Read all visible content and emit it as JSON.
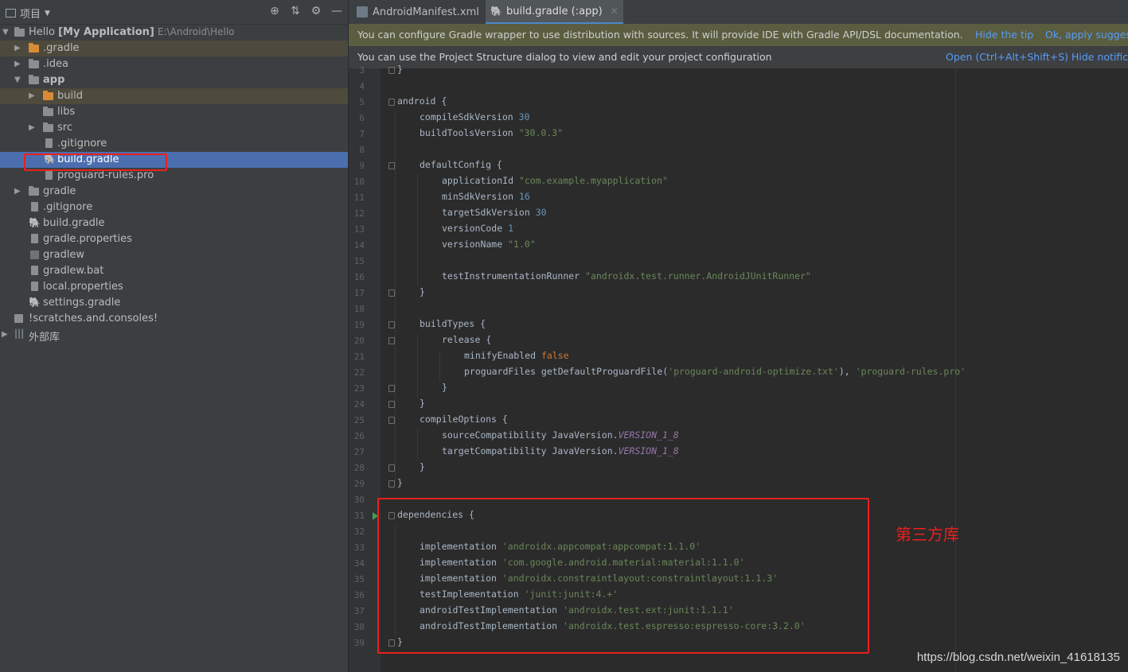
{
  "project_panel": {
    "title": "项目",
    "tree": [
      {
        "label_bold": "Hello",
        "label_extra": "[My Application]",
        "path": "E:\\Android\\Hello"
      },
      {
        "label": ".gradle"
      },
      {
        "label": ".idea"
      },
      {
        "label": "app"
      },
      {
        "label": "build"
      },
      {
        "label": "libs"
      },
      {
        "label": "src"
      },
      {
        "label": ".gitignore"
      },
      {
        "label": "build.gradle"
      },
      {
        "label": "proguard-rules.pro"
      },
      {
        "label": "gradle"
      },
      {
        "label": ".gitignore"
      },
      {
        "label": "build.gradle"
      },
      {
        "label": "gradle.properties"
      },
      {
        "label": "gradlew"
      },
      {
        "label": "gradlew.bat"
      },
      {
        "label": "local.properties"
      },
      {
        "label": "settings.gradle"
      },
      {
        "label": "!scratches.and.consoles!"
      },
      {
        "label": "外部库"
      }
    ]
  },
  "tabs": [
    {
      "label": "AndroidManifest.xml"
    },
    {
      "label": "build.gradle (:app)"
    }
  ],
  "banners": {
    "gradle_wrapper": {
      "message": "You can configure Gradle wrapper to use distribution with sources. It will provide IDE with Gradle API/DSL documentation.",
      "hide_link": "Hide the tip",
      "apply_link": "Ok, apply suggest"
    },
    "project_structure": {
      "message": "You can use the Project Structure dialog to view and edit your project configuration",
      "open_link": "Open (Ctrl+Alt+Shift+S)",
      "hide_link": "Hide notifica"
    }
  },
  "line_numbers": [
    "3",
    "4",
    "5",
    "6",
    "7",
    "8",
    "9",
    "10",
    "11",
    "12",
    "13",
    "14",
    "15",
    "16",
    "17",
    "18",
    "19",
    "20",
    "21",
    "22",
    "23",
    "24",
    "25",
    "26",
    "27",
    "28",
    "29",
    "30",
    "31",
    "32",
    "33",
    "34",
    "35",
    "36",
    "37",
    "38",
    "39"
  ],
  "code": {
    "l3": "}",
    "l5a": "android {",
    "l6a": "compileSdkVersion ",
    "l6b": "30",
    "l7a": "buildToolsVersion ",
    "l7b": "\"30.0.3\"",
    "l9a": "defaultConfig {",
    "l10a": "applicationId ",
    "l10b": "\"com.example.myapplication\"",
    "l11a": "minSdkVersion ",
    "l11b": "16",
    "l12a": "targetSdkVersion ",
    "l12b": "30",
    "l13a": "versionCode ",
    "l13b": "1",
    "l14a": "versionName ",
    "l14b": "\"1.0\"",
    "l16a": "testInstrumentationRunner ",
    "l16b": "\"androidx.test.runner.AndroidJUnitRunner\"",
    "l17": "}",
    "l19": "buildTypes {",
    "l20": "release {",
    "l21a": "minifyEnabled ",
    "l21b": "false",
    "l22a": "proguardFiles getDefaultProguardFile(",
    "l22b": "'proguard-android-optimize.txt'",
    "l22c": "), ",
    "l22d": "'proguard-rules.pro'",
    "l23": "}",
    "l24": "}",
    "l25": "compileOptions {",
    "l26a": "sourceCompatibility JavaVersion.",
    "l26b": "VERSION_1_8",
    "l27a": "targetCompatibility JavaVersion.",
    "l27b": "VERSION_1_8",
    "l28": "}",
    "l29": "}",
    "l31": "dependencies {",
    "l33a": "implementation ",
    "l33b": "'androidx.appcompat:appcompat:1.1.0'",
    "l34a": "implementation ",
    "l34b": "'com.google.android.material:material:1.1.0'",
    "l35a": "implementation ",
    "l35b": "'androidx.constraintlayout:constraintlayout:1.1.3'",
    "l36a": "testImplementation ",
    "l36b": "'junit:junit:4.+'",
    "l37a": "androidTestImplementation ",
    "l37b": "'androidx.test.ext:junit:1.1.1'",
    "l38a": "androidTestImplementation ",
    "l38b": "'androidx.test.espresso:espresso-core:3.2.0'",
    "l39": "}"
  },
  "annotation": "第三方库",
  "watermark": "https://blog.csdn.net/weixin_41618135",
  "colors": {
    "highlight_red": "#e8211d",
    "selection": "#4b6eaf",
    "link": "#589df6"
  }
}
